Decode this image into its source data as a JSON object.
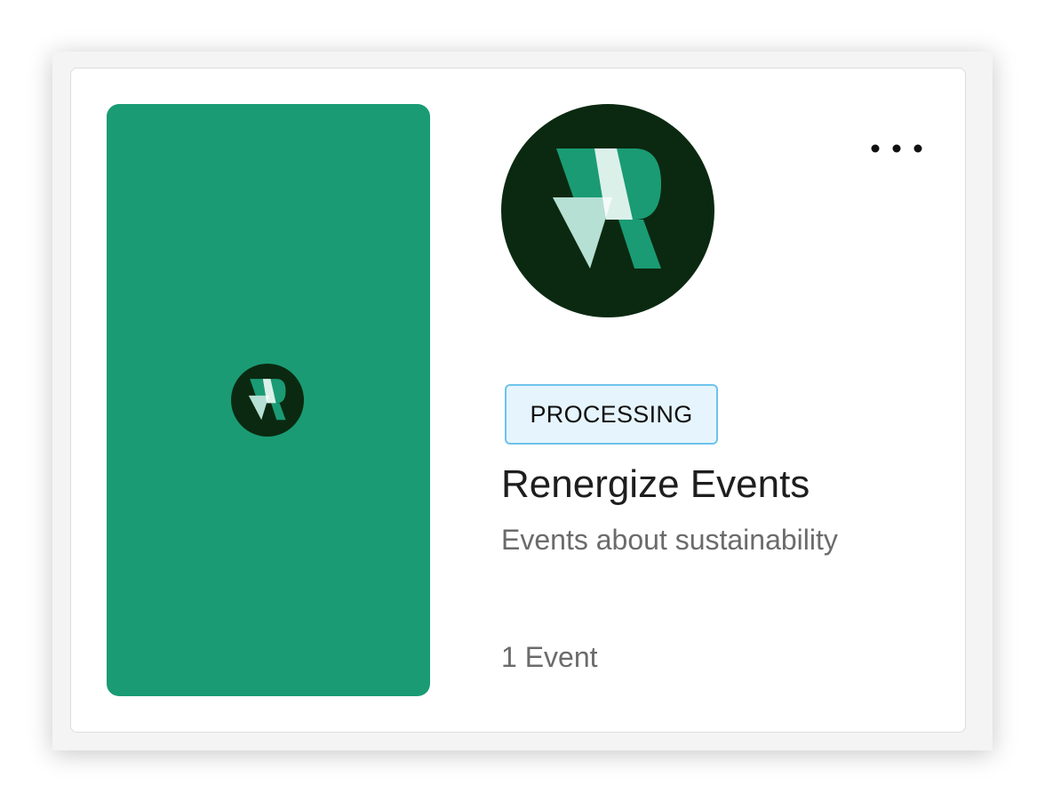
{
  "card": {
    "status": "PROCESSING",
    "title": "Renergize Events",
    "description": "Events about sustainability",
    "event_count": "1 Event"
  },
  "icons": {
    "more": "more-horizontal-icon",
    "logo": "renergize-logo"
  },
  "colors": {
    "cover_bg": "#1a9b74",
    "logo_dark": "#0b2910",
    "logo_green": "#1a9b74",
    "logo_light": "#b5e0d3",
    "badge_bg": "#e6f5fd",
    "badge_border": "#6ec3ec"
  }
}
